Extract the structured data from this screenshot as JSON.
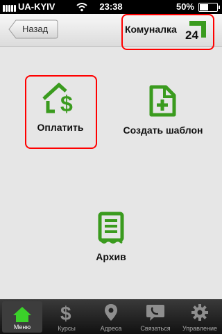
{
  "status": {
    "carrier": "UA-KYIV",
    "time": "23:38",
    "battery": "50%",
    "battery_level": 0.5
  },
  "nav": {
    "back_label": "Назад",
    "title": "Комуналка",
    "logo_text": "24"
  },
  "actions": {
    "pay": "Оплатить",
    "template": "Создать шаблон",
    "archive": "Архив"
  },
  "tabs": [
    {
      "label": "Меню",
      "icon": "home-icon",
      "active": true
    },
    {
      "label": "Курсы",
      "icon": "dollar-icon",
      "active": false
    },
    {
      "label": "Адреса",
      "icon": "map-pin-icon",
      "active": false
    },
    {
      "label": "Связаться",
      "icon": "phone-chat-icon",
      "active": false
    },
    {
      "label": "Управление",
      "icon": "gear-icon",
      "active": false
    }
  ],
  "colors": {
    "accent": "#3a9b1e",
    "highlight": "#ff0000"
  }
}
